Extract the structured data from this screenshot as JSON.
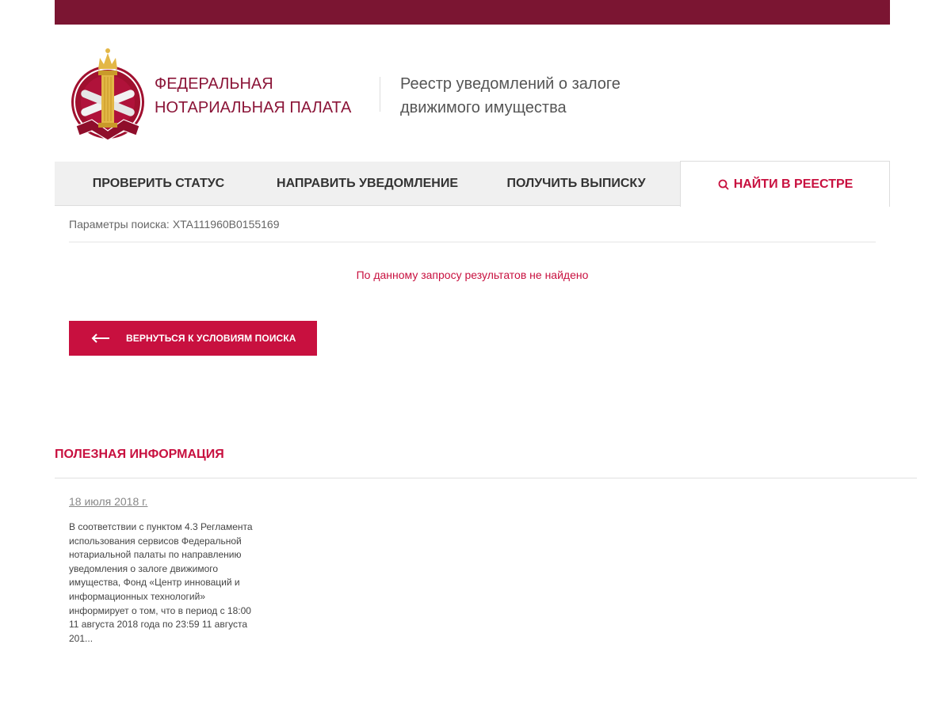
{
  "header": {
    "org_name_line1": "ФЕДЕРАЛЬНАЯ",
    "org_name_line2": "НОТАРИАЛЬНАЯ ПАЛАТА",
    "registry_line1": "Реестр уведомлений о залоге",
    "registry_line2": "движимого имущества",
    "logo_icon": "notary-emblem-icon"
  },
  "nav": {
    "tabs": [
      {
        "label": "ПРОВЕРИТЬ СТАТУС",
        "active": false
      },
      {
        "label": "НАПРАВИТЬ УВЕДОМЛЕНИЕ",
        "active": false
      },
      {
        "label": "ПОЛУЧИТЬ ВЫПИСКУ",
        "active": false
      },
      {
        "label": "НАЙТИ В РЕЕСТРЕ",
        "active": true,
        "icon": "search-icon"
      }
    ]
  },
  "search": {
    "params_label": "Параметры поиска:",
    "params_value": "XTA111960B0155169",
    "no_results": "По данному запросу результатов не найдено",
    "back_label": "ВЕРНУТЬСЯ К УСЛОВИЯМ ПОИСКА",
    "back_icon": "arrow-left-icon"
  },
  "useful": {
    "title": "ПОЛЕЗНАЯ ИНФОРМАЦИЯ",
    "news": [
      {
        "date": "18 июля 2018 г.",
        "text": "В соответствии с пунктом 4.3 Регламента использования сервисов Федеральной нотариальной палаты по направлению уведомления о залоге движимого имущества, Фонд «Центр инноваций и информационных технологий» информирует о том, что в период с 18:00 11 августа 2018 года по 23:59 11 августа 201..."
      }
    ]
  },
  "colors": {
    "brand_dark": "#7b1532",
    "accent": "#c8103f",
    "gold": "#e3b746"
  }
}
